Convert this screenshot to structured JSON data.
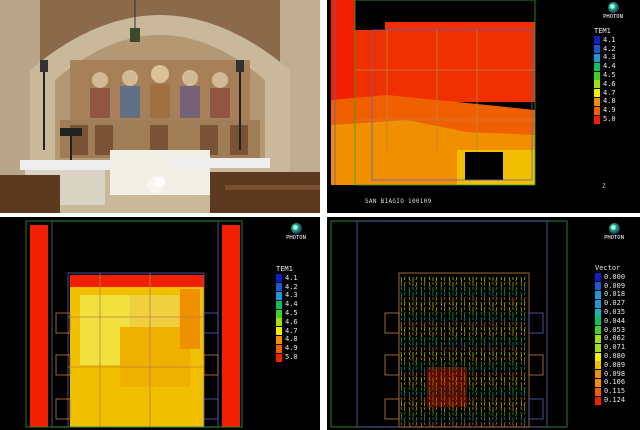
{
  "panels": {
    "photo": {
      "label": "Church interior photograph"
    },
    "top_right": {
      "logo_text": "PHOTON",
      "legend_title": "TEM1",
      "legend_values": [
        "4.1",
        "4.2",
        "4.3",
        "4.4",
        "4.5",
        "4.6",
        "4.7",
        "4.8",
        "4.9",
        "5.0"
      ],
      "caption": "SAN BIAGIO 100109",
      "axis_label": "Z"
    },
    "bottom_left": {
      "logo_text": "PHOTON",
      "legend_title": "TEM1",
      "legend_values": [
        "4.1",
        "4.2",
        "4.3",
        "4.4",
        "4.5",
        "4.6",
        "4.7",
        "4.8",
        "4.9",
        "5.0"
      ]
    },
    "bottom_right": {
      "logo_text": "PHOTON",
      "legend_title": "Vector",
      "legend_values": [
        "0.000",
        "0.009",
        "0.018",
        "0.027",
        "0.035",
        "0.044",
        "0.053",
        "0.062",
        "0.071",
        "0.080",
        "0.089",
        "0.098",
        "0.106",
        "0.115",
        "0.124"
      ]
    }
  },
  "colors": {
    "scale": [
      "#1020c0",
      "#1a5ad0",
      "#1a9ad8",
      "#10b8b0",
      "#10c060",
      "#40d020",
      "#a0e010",
      "#f0f000",
      "#f0c000",
      "#f09000",
      "#f06000",
      "#f02000"
    ]
  }
}
